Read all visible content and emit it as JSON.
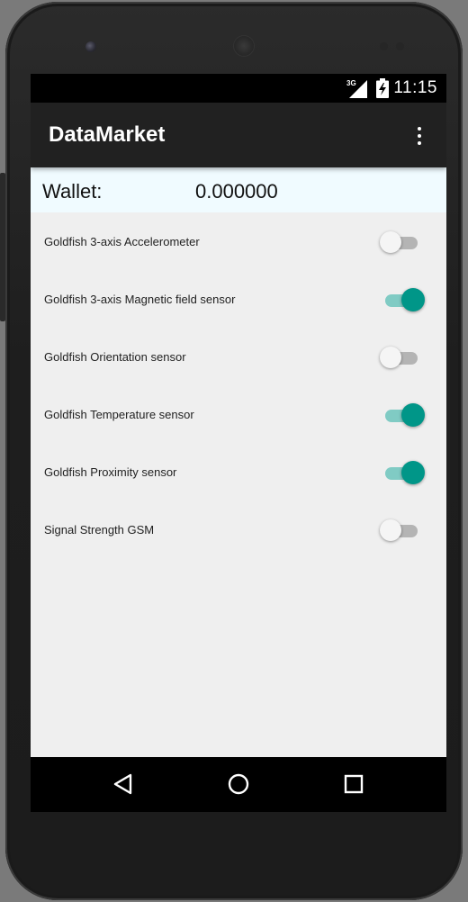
{
  "status_bar": {
    "network_type": "3G",
    "time": "11:15",
    "signal_icon": "signal-icon",
    "battery_icon": "battery-charging-icon"
  },
  "app_bar": {
    "title": "DataMarket",
    "overflow_icon": "more-vert-icon"
  },
  "wallet": {
    "label": "Wallet:",
    "value": "0.000000"
  },
  "sensors": [
    {
      "label": "Goldfish 3-axis Accelerometer",
      "enabled": false
    },
    {
      "label": "Goldfish 3-axis Magnetic field sensor",
      "enabled": true
    },
    {
      "label": "Goldfish Orientation sensor",
      "enabled": false
    },
    {
      "label": "Goldfish Temperature sensor",
      "enabled": true
    },
    {
      "label": "Goldfish Proximity sensor",
      "enabled": true
    },
    {
      "label": "Signal Strength GSM",
      "enabled": false
    }
  ],
  "nav_bar": {
    "back_icon": "back-triangle-icon",
    "home_icon": "home-circle-icon",
    "recents_icon": "recents-square-icon"
  },
  "colors": {
    "accent": "#009688",
    "accent_track": "#80cbc4",
    "app_bar": "#212121",
    "wallet_bg": "#f0fbff"
  }
}
